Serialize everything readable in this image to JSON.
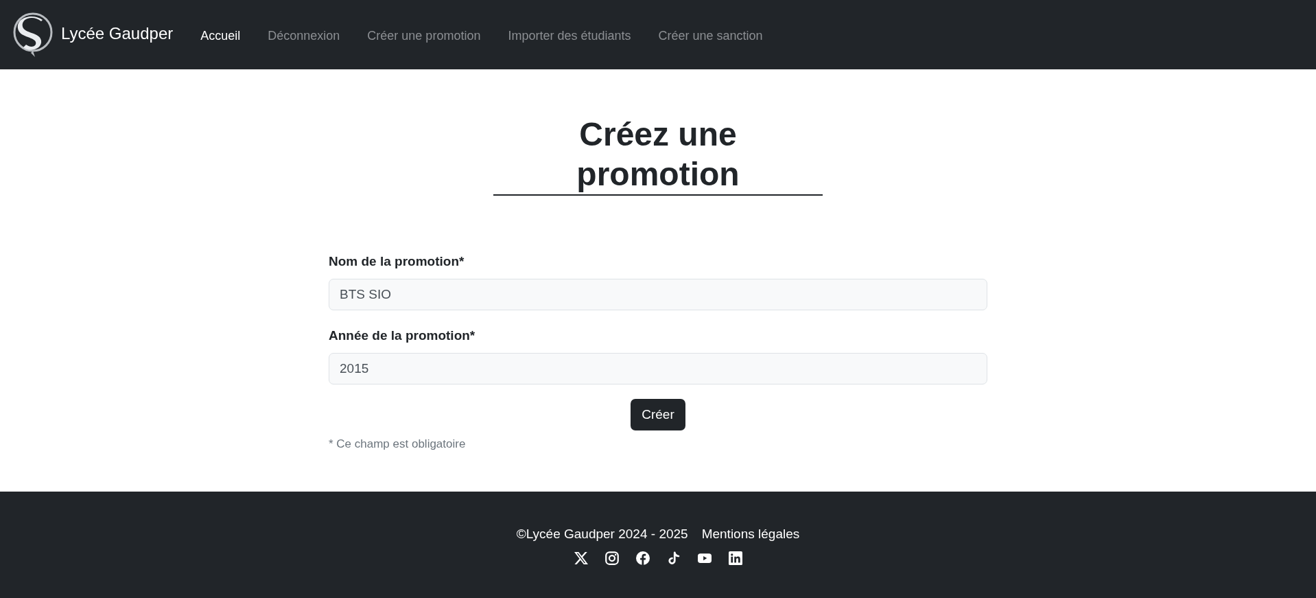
{
  "header": {
    "brand": "Lycée Gaudper",
    "nav": [
      {
        "label": "Accueil",
        "selected": true
      },
      {
        "label": "Déconnexion",
        "selected": false
      },
      {
        "label": "Créer une promotion",
        "selected": false
      },
      {
        "label": "Importer des étudiants",
        "selected": false
      },
      {
        "label": "Créer une sanction",
        "selected": false
      }
    ]
  },
  "page": {
    "title": "Créez une promotion"
  },
  "form": {
    "fields": [
      {
        "label": "Nom de la promotion*",
        "value": "BTS SIO"
      },
      {
        "label": "Année de la promotion*",
        "value": "2015"
      }
    ],
    "submit": "Créer",
    "note": "* Ce champ est obligatoire"
  },
  "footer": {
    "copyright": "©Lycée Gaudper 2024 - 2025",
    "link": "Mentions légales",
    "social": [
      {
        "kind": "x"
      },
      {
        "kind": "instagram"
      },
      {
        "kind": "facebook"
      },
      {
        "kind": "tiktok"
      },
      {
        "kind": "youtube"
      },
      {
        "kind": "linkedin"
      }
    ]
  }
}
